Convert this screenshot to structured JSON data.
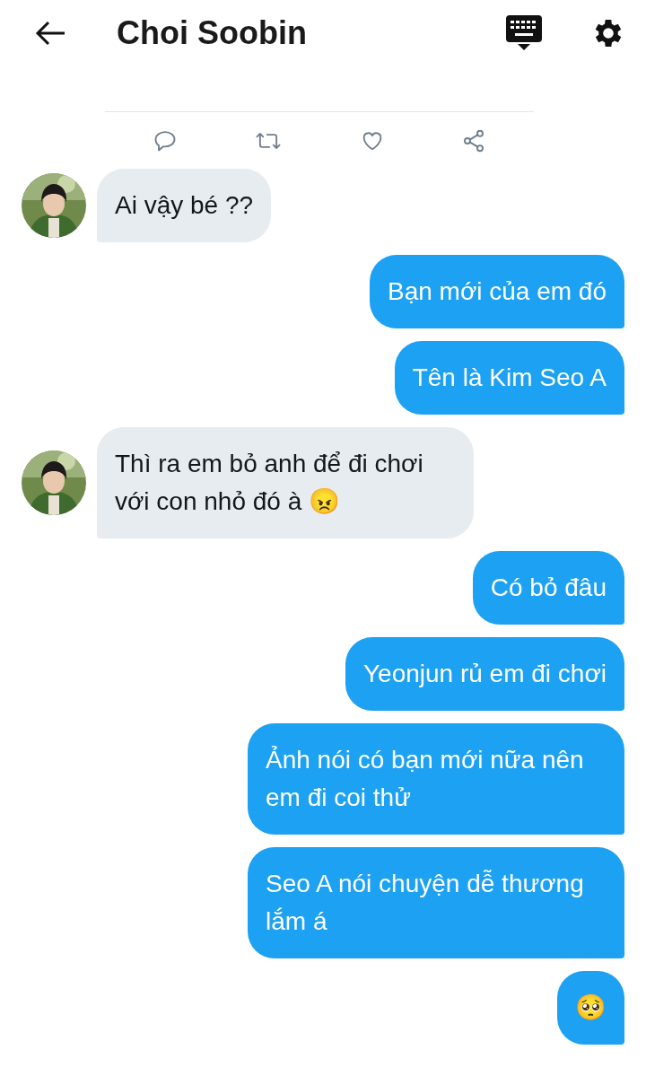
{
  "header": {
    "title": "Choi Soobin"
  },
  "messages": [
    {
      "kind": "received",
      "text": "Ai vậy bé ??"
    },
    {
      "kind": "sent",
      "text": "Bạn mới của em đó"
    },
    {
      "kind": "sent",
      "text": "Tên là Kim Seo A"
    },
    {
      "kind": "received",
      "text": "Thì ra em bỏ anh để đi chơi với con nhỏ đó à 😠"
    },
    {
      "kind": "sent",
      "text": "Có bỏ đâu"
    },
    {
      "kind": "sent",
      "text": "Yeonjun rủ em đi chơi"
    },
    {
      "kind": "sent",
      "text": "Ảnh nói có bạn mới nữa nên em đi coi thử"
    },
    {
      "kind": "sent",
      "text": "Seo A nói chuyện dễ thương lắm á"
    },
    {
      "kind": "sent",
      "text": "🥺"
    }
  ]
}
